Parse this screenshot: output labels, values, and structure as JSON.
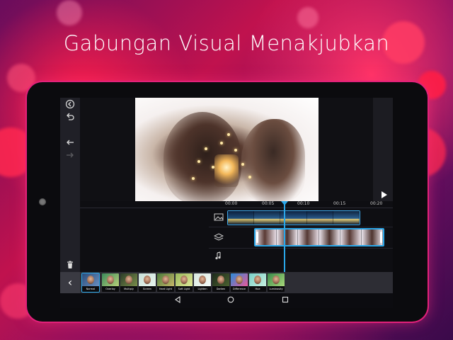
{
  "headline": "Gabungan Visual Menakjubkan",
  "colors": {
    "accent": "#2aa7e9",
    "tablet_glow": "#e2217a",
    "background": "#c0124e"
  },
  "editor": {
    "left_rail": {
      "icons": [
        "back-icon",
        "undo-icon",
        "undo-icon",
        "redo-icon"
      ]
    },
    "right_rail": {
      "icons": [
        "play-icon"
      ]
    },
    "timeline": {
      "ruler_labels": [
        "00:00",
        "00:05",
        "00:10",
        "00:15",
        "00:20"
      ],
      "tracks": [
        {
          "icon": "image-track-icon"
        },
        {
          "icon": "layer-track-icon"
        },
        {
          "icon": "music-track-icon"
        }
      ]
    },
    "blend_modes": {
      "items": [
        "Normal",
        "Overlay",
        "Multiply",
        "Screen",
        "Hard Light",
        "Soft Light",
        "Lighten",
        "Darken",
        "Difference",
        "Hue",
        "Luminosity"
      ],
      "selected": "Normal"
    },
    "system_nav": {
      "icons": [
        "back-icon",
        "home-icon",
        "recents-icon"
      ]
    }
  }
}
